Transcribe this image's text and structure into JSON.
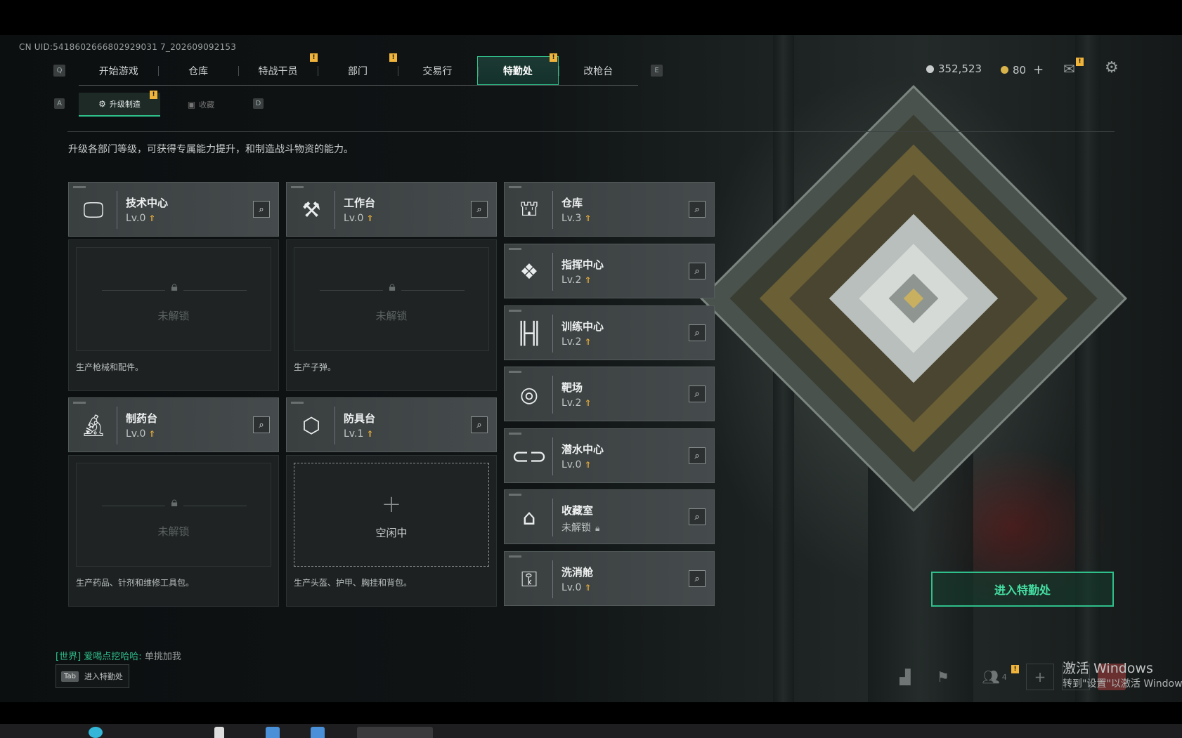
{
  "uid": "CN UID:5418602666802929031 7_202609092153",
  "nav": {
    "left_key": "Q",
    "right_key": "E",
    "tabs": [
      {
        "label": "开始游戏",
        "warn": false
      },
      {
        "label": "仓库",
        "warn": false
      },
      {
        "label": "特战干员",
        "warn": true
      },
      {
        "label": "部门",
        "warn": true
      },
      {
        "label": "交易行",
        "warn": false
      },
      {
        "label": "特勤处",
        "warn": true,
        "active": true
      },
      {
        "label": "改枪台",
        "warn": false
      }
    ],
    "warn_mark": "!"
  },
  "subnav": {
    "left_key": "A",
    "right_key": "D",
    "tabs": [
      {
        "label": "升级制造",
        "active": true
      },
      {
        "label": "收藏"
      }
    ]
  },
  "description": "升级各部门等级，可获得专属能力提升，和制造战斗物资的能力。",
  "currency": {
    "silver": "352,523",
    "gold": "80",
    "gold_plus": "+"
  },
  "cards": {
    "tech": {
      "name": "技术中心",
      "level": "Lv.0",
      "locked_text": "未解锁",
      "produces": "生产枪械和配件。"
    },
    "workbench": {
      "name": "工作台",
      "level": "Lv.0",
      "locked_text": "未解锁",
      "produces": "生产子弹。"
    },
    "pharmacy": {
      "name": "制药台",
      "level": "Lv.0",
      "locked_text": "未解锁",
      "produces": "生产药品、针剂和维修工具包。"
    },
    "armor": {
      "name": "防具台",
      "level": "Lv.1",
      "idle_text": "空闲中",
      "produces": "生产头盔、护甲、胸挂和背包。"
    }
  },
  "departments": [
    {
      "name": "仓库",
      "level": "Lv.3"
    },
    {
      "name": "指挥中心",
      "level": "Lv.2"
    },
    {
      "name": "训练中心",
      "level": "Lv.2"
    },
    {
      "name": "靶场",
      "level": "Lv.2"
    },
    {
      "name": "潜水中心",
      "level": "Lv.0"
    },
    {
      "name": "收藏室",
      "level": "未解锁"
    },
    {
      "name": "洗消舱",
      "level": "Lv.0"
    }
  ],
  "enter_button": "进入特勤处",
  "chat": {
    "channel": "[世界]",
    "user": "爱喝点挖哈哈:",
    "message": "单挑加我"
  },
  "tab_hint": {
    "key": "Tab",
    "label": "进入特勤处"
  },
  "bottom": {
    "friends_count": "4"
  },
  "watermark": {
    "line1": "激活 Windows",
    "line2": "转到\"设置\"以激活 Windows"
  },
  "colors": {
    "accent": "#2fbf8b",
    "warn": "#f0b43a",
    "panel": "#3a3f40"
  }
}
